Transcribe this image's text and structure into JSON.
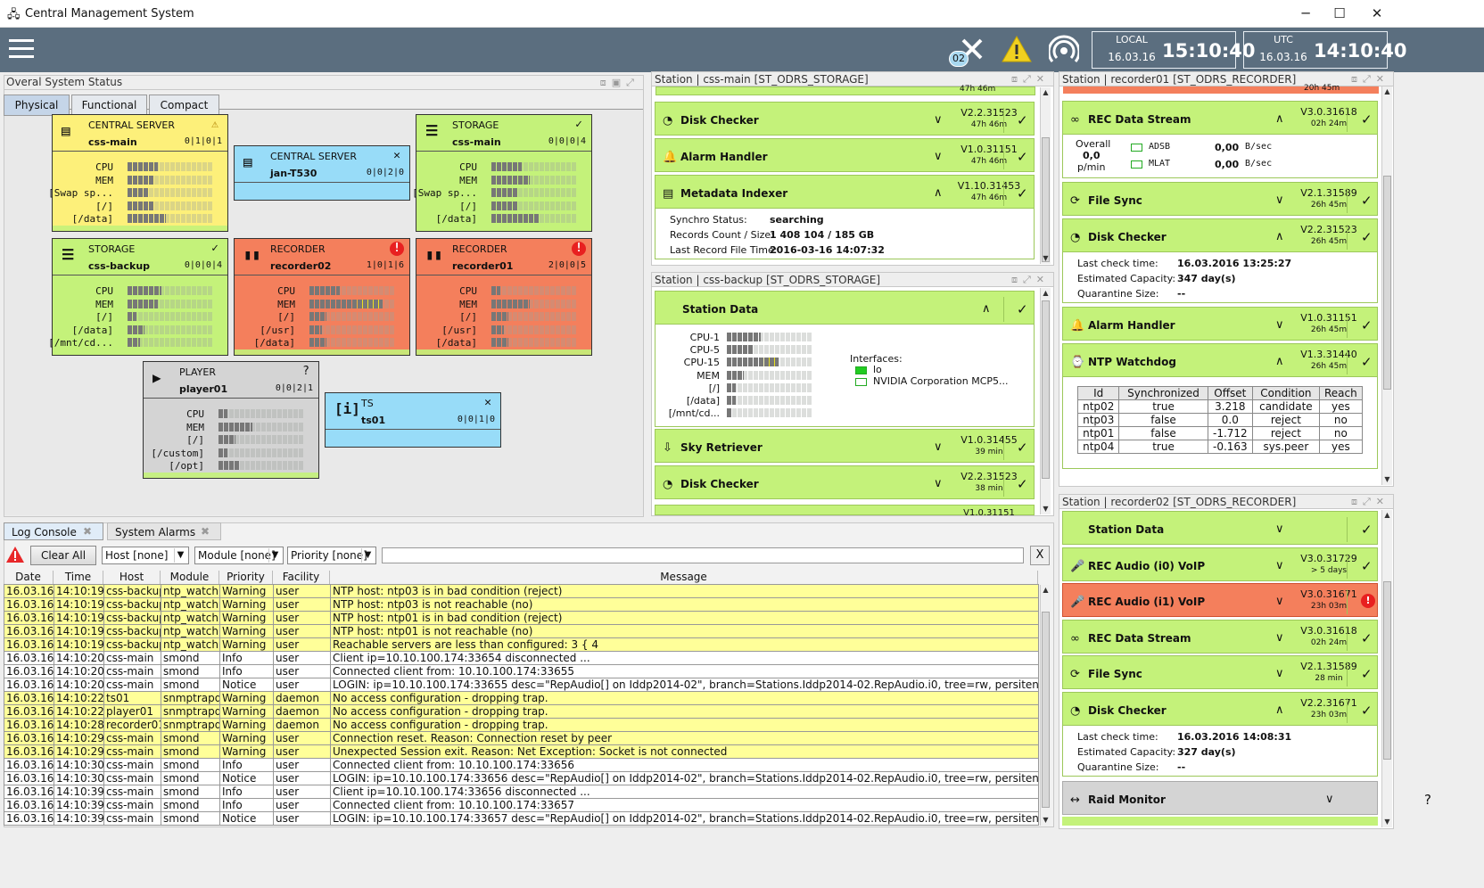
{
  "window": {
    "title": "Central Management System",
    "min": "─",
    "max": "☐",
    "close": "✕"
  },
  "topbar": {
    "badge": "02",
    "local": {
      "label": "LOCAL",
      "date": "16.03.16",
      "time": "15:10:40"
    },
    "utc": {
      "label": "UTC",
      "date": "16.03.16",
      "time": "14:10:40"
    }
  },
  "overall": {
    "title": "Overal System Status",
    "tabs": [
      "Physical",
      "Functional",
      "Compact"
    ]
  },
  "tiles": [
    {
      "type": "CENTRAL SERVER",
      "name": "css-main",
      "counts": "0|1|0|1",
      "status": "⚠",
      "color": "#fdf07a",
      "metrics": [
        {
          "l": "CPU",
          "f": 0.35
        },
        {
          "l": "MEM",
          "f": 0.3
        },
        {
          "l": "[Swap sp...",
          "f": 0.25
        },
        {
          "l": "[/]",
          "f": 0.3
        },
        {
          "l": "[/data]",
          "f": 0.45
        }
      ]
    },
    {
      "type": "CENTRAL SERVER",
      "name": "jan-T530",
      "counts": "0|0|2|0",
      "status": "✕",
      "color": "#98dcf8",
      "metrics": []
    },
    {
      "type": "STORAGE",
      "name": "css-main",
      "counts": "0|0|0|4",
      "status": "✓",
      "color": "#c4f27a",
      "metrics": [
        {
          "l": "CPU",
          "f": 0.35
        },
        {
          "l": "MEM",
          "f": 0.45
        },
        {
          "l": "[Swap sp...",
          "f": 0.3
        },
        {
          "l": "[/]",
          "f": 0.3
        },
        {
          "l": "[/data]",
          "f": 0.55
        }
      ]
    },
    {
      "type": "STORAGE",
      "name": "css-backup",
      "counts": "0|0|0|4",
      "status": "✓",
      "color": "#c4f27a",
      "metrics": [
        {
          "l": "CPU",
          "f": 0.4
        },
        {
          "l": "MEM",
          "f": 0.35
        },
        {
          "l": "[/]",
          "f": 0.1
        },
        {
          "l": "[/data]",
          "f": 0.2
        },
        {
          "l": "[/mnt/cd...",
          "f": 0.15
        }
      ]
    },
    {
      "type": "RECORDER",
      "name": "recorder02",
      "counts": "1|0|1|6",
      "status": "!",
      "color": "#f47f5c",
      "metrics": [
        {
          "l": "CPU",
          "f": 0.35
        },
        {
          "l": "MEM",
          "f": 0.85
        },
        {
          "l": "[/]",
          "f": 0.2
        },
        {
          "l": "[/usr]",
          "f": 0.15
        },
        {
          "l": "[/data]",
          "f": 0.2
        }
      ]
    },
    {
      "type": "RECORDER",
      "name": "recorder01",
      "counts": "2|0|0|5",
      "status": "!",
      "color": "#f47f5c",
      "metrics": [
        {
          "l": "CPU",
          "f": 0.1
        },
        {
          "l": "MEM",
          "f": 0.45
        },
        {
          "l": "[/]",
          "f": 0.2
        },
        {
          "l": "[/usr]",
          "f": 0.15
        },
        {
          "l": "[/data]",
          "f": 0.2
        }
      ]
    },
    {
      "type": "PLAYER",
      "name": "player01",
      "counts": "0|0|2|1",
      "status": "?",
      "color": "#d4d4d4",
      "metrics": [
        {
          "l": "CPU",
          "f": 0.1
        },
        {
          "l": "MEM",
          "f": 0.4
        },
        {
          "l": "[/]",
          "f": 0.2
        },
        {
          "l": "[/custom]",
          "f": 0.1
        },
        {
          "l": "[/opt]",
          "f": 0.25
        }
      ]
    },
    {
      "type": "TS",
      "name": "ts01",
      "counts": "0|0|1|0",
      "status": "✕",
      "color": "#98dcf8",
      "metrics": []
    }
  ],
  "station_main": {
    "title": "Station | css-main [ST_ODRS_STORAGE]",
    "top_time": "47h 46m",
    "cards": [
      {
        "name": "Disk Checker",
        "icon": "◔",
        "ver": "V2.2.31523",
        "time": "47h 46m"
      },
      {
        "name": "Alarm Handler",
        "icon": "🔔",
        "ver": "V1.0.31151",
        "time": "47h 46m"
      },
      {
        "name": "Metadata Indexer",
        "icon": "▤",
        "ver": "V1.10.31453",
        "time": "47h 46m"
      }
    ],
    "details": [
      {
        "k": "Synchro Status:",
        "v": "searching"
      },
      {
        "k": "Records Count / Size:",
        "v": "1 408 104 / 185 GB"
      },
      {
        "k": "Last Record File Time:",
        "v": "2016-03-16 14:07:32"
      }
    ]
  },
  "station_backup": {
    "title": "Station | css-backup [ST_ODRS_STORAGE]",
    "card": "Station Data",
    "metrics": [
      "CPU-1",
      "CPU-5",
      "CPU-15",
      "MEM",
      "[/]",
      "[/data]",
      "[/mnt/cd..."
    ],
    "ifaces_label": "Interfaces:",
    "ifaces": [
      "lo",
      "NVIDIA Corporation MCP5..."
    ],
    "cards": [
      {
        "name": "Sky Retriever",
        "icon": "⇩",
        "ver": "V1.0.31455",
        "time": "39 min"
      },
      {
        "name": "Disk Checker",
        "icon": "◔",
        "ver": "V2.2.31523",
        "time": "38 min"
      }
    ],
    "peek_ver": "V1.0.31151"
  },
  "rec01": {
    "title": "Station | recorder01 [ST_ODRS_RECORDER]",
    "top_time": "20h 45m",
    "stream": {
      "name": "REC Data Stream",
      "ver": "V3.0.31618",
      "time": "02h 24m",
      "overall_label": "Overall",
      "overall_val": "0,0",
      "overall_unit": "p/min",
      "rows": [
        {
          "n": "ADSB",
          "v": "0,00",
          "u": "B/sec"
        },
        {
          "n": "MLAT",
          "v": "0,00",
          "u": "B/sec"
        }
      ]
    },
    "sync": {
      "name": "File Sync",
      "ver": "V2.1.31589",
      "time": "26h 45m"
    },
    "disk": {
      "name": "Disk Checker",
      "ver": "V2.2.31523",
      "time": "26h 45m",
      "rows": [
        {
          "k": "Last check time:",
          "v": "16.03.2016   13:25:27"
        },
        {
          "k": "Estimated Capacity:",
          "v": "347 day(s)"
        },
        {
          "k": "Quarantine Size:",
          "v": "--"
        }
      ]
    },
    "alarm": {
      "name": "Alarm Handler",
      "ver": "V1.0.31151",
      "time": "26h 45m"
    },
    "ntp": {
      "name": "NTP Watchdog",
      "ver": "V1.3.31440",
      "time": "26h 45m",
      "cols": [
        "Id",
        "Synchronized",
        "Offset",
        "Condition",
        "Reach"
      ],
      "rows": [
        [
          "ntp02",
          "true",
          "3.218",
          "candidate",
          "yes"
        ],
        [
          "ntp03",
          "false",
          "0.0",
          "reject",
          "no"
        ],
        [
          "ntp01",
          "false",
          "-1.712",
          "reject",
          "no"
        ],
        [
          "ntp04",
          "true",
          "-0.163",
          "sys.peer",
          "yes"
        ]
      ]
    }
  },
  "rec02": {
    "title": "Station | recorder02 [ST_ODRS_RECORDER]",
    "cards": [
      {
        "name": "Station Data",
        "icon": "",
        "ver": "",
        "time": "",
        "c": "g"
      },
      {
        "name": "REC Audio (i0) VoIP",
        "icon": "🎤",
        "ver": "V3.0.31729",
        "time": "> 5 days",
        "c": "g"
      },
      {
        "name": "REC Audio (i1) VoIP",
        "icon": "🎤",
        "ver": "V3.0.31671",
        "time": "23h 03m",
        "c": "r"
      },
      {
        "name": "REC Data Stream",
        "icon": "∞",
        "ver": "V3.0.31618",
        "time": "02h 24m",
        "c": "g"
      },
      {
        "name": "File Sync",
        "icon": "⟳",
        "ver": "V2.1.31589",
        "time": "28 min",
        "c": "g"
      }
    ],
    "disk": {
      "name": "Disk Checker",
      "ver": "V2.2.31671",
      "time": "23h 03m",
      "rows": [
        {
          "k": "Last check time:",
          "v": "16.03.2016   14:08:31"
        },
        {
          "k": "Estimated Capacity:",
          "v": "327 day(s)"
        },
        {
          "k": "Quarantine Size:",
          "v": "--"
        }
      ]
    },
    "raid": {
      "name": "Raid Monitor",
      "status": "?"
    }
  },
  "log": {
    "tabs": [
      "Log Console",
      "System Alarms"
    ],
    "clear": "Clear All",
    "filters": [
      "Host [none]",
      "Module [none]",
      "Priority [none]"
    ],
    "cols": [
      "Date",
      "Time",
      "Host",
      "Module",
      "Priority",
      "Facility",
      "Message"
    ],
    "rows": [
      [
        "16.03.16",
        "14:10:19",
        "css-backup",
        "ntp_watch...",
        "Warning",
        "user",
        "NTP host: ntp03  is in bad condition (reject)"
      ],
      [
        "16.03.16",
        "14:10:19",
        "css-backup",
        "ntp_watch...",
        "Warning",
        "user",
        "NTP host: ntp03  is not reachable (no)"
      ],
      [
        "16.03.16",
        "14:10:19",
        "css-backup",
        "ntp_watch...",
        "Warning",
        "user",
        "NTP host: ntp01  is in bad condition (reject)"
      ],
      [
        "16.03.16",
        "14:10:19",
        "css-backup",
        "ntp_watch...",
        "Warning",
        "user",
        "NTP host: ntp01  is not reachable (no)"
      ],
      [
        "16.03.16",
        "14:10:19",
        "css-backup",
        "ntp_watch...",
        "Warning",
        "user",
        "Reachable servers are less than configured: 3 { 4"
      ],
      [
        "16.03.16",
        "14:10:20",
        "css-main",
        "smond",
        "Info",
        "user",
        "Client ip=10.10.100.174:33654 disconnected ..."
      ],
      [
        "16.03.16",
        "14:10:20",
        "css-main",
        "smond",
        "Info",
        "user",
        "Connected client from: 10.10.100.174:33655"
      ],
      [
        "16.03.16",
        "14:10:20",
        "css-main",
        "smond",
        "Notice",
        "user",
        "LOGIN: ip=10.10.100.174:33655 desc=\"RepAudio[] on Iddp2014-02\", branch=Stations.Iddp2014-02.RepAudio.i0, tree=rw, persitence=rw"
      ],
      [
        "16.03.16",
        "14:10:22",
        "ts01",
        "snmptrapd",
        "Warning",
        "daemon",
        "No access configuration - dropping trap."
      ],
      [
        "16.03.16",
        "14:10:22",
        "player01",
        "snmptrapd",
        "Warning",
        "daemon",
        "No access configuration - dropping trap."
      ],
      [
        "16.03.16",
        "14:10:28",
        "recorder01",
        "snmptrapd",
        "Warning",
        "daemon",
        "No access configuration - dropping trap."
      ],
      [
        "16.03.16",
        "14:10:29",
        "css-main",
        "smond",
        "Warning",
        "user",
        "Connection reset. Reason: Connection reset by peer"
      ],
      [
        "16.03.16",
        "14:10:29",
        "css-main",
        "smond",
        "Warning",
        "user",
        "Unexpected Session exit. Reason: Net Exception: Socket is not connected"
      ],
      [
        "16.03.16",
        "14:10:30",
        "css-main",
        "smond",
        "Info",
        "user",
        "Connected client from: 10.10.100.174:33656"
      ],
      [
        "16.03.16",
        "14:10:30",
        "css-main",
        "smond",
        "Notice",
        "user",
        "LOGIN: ip=10.10.100.174:33656 desc=\"RepAudio[] on Iddp2014-02\", branch=Stations.Iddp2014-02.RepAudio.i0, tree=rw, persitence=rw"
      ],
      [
        "16.03.16",
        "14:10:39",
        "css-main",
        "smond",
        "Info",
        "user",
        "Client ip=10.10.100.174:33656 disconnected ..."
      ],
      [
        "16.03.16",
        "14:10:39",
        "css-main",
        "smond",
        "Info",
        "user",
        "Connected client from: 10.10.100.174:33657"
      ],
      [
        "16.03.16",
        "14:10:39",
        "css-main",
        "smond",
        "Notice",
        "user",
        "LOGIN: ip=10.10.100.174:33657 desc=\"RepAudio[] on Iddp2014-02\", branch=Stations.Iddp2014-02.RepAudio.i0, tree=rw, persitence=rw"
      ]
    ]
  }
}
